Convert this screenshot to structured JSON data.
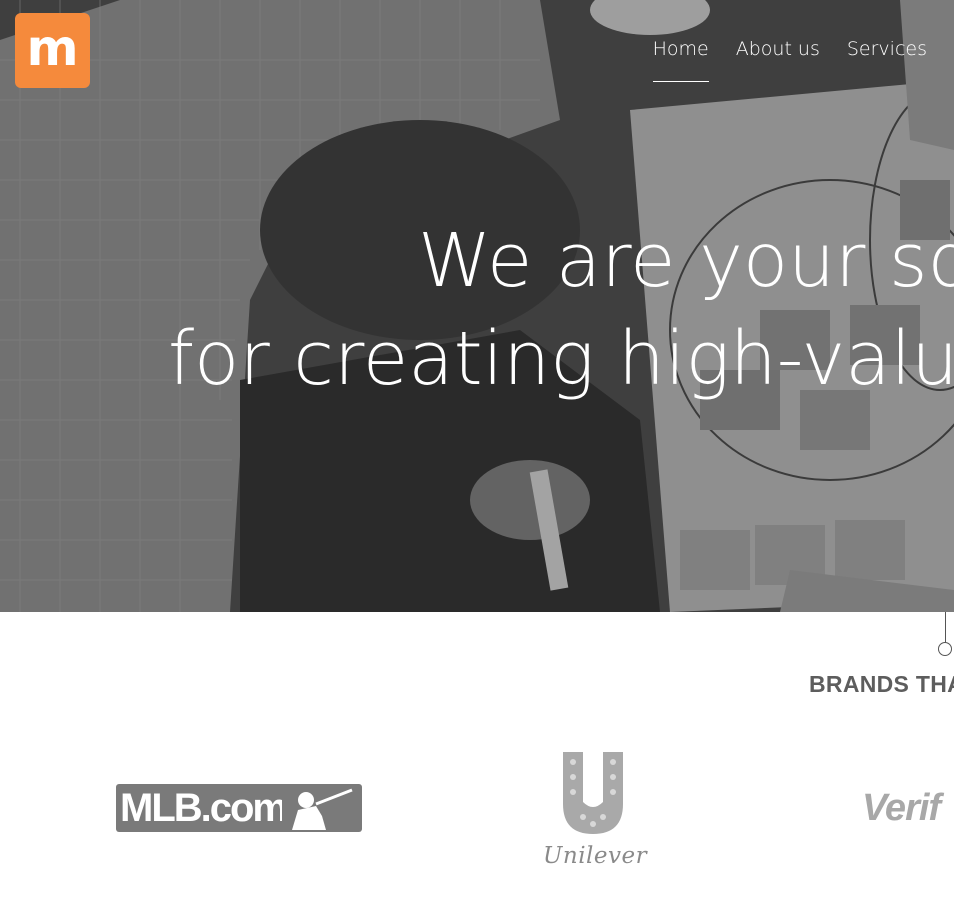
{
  "logo": {
    "letter": "m",
    "color": "#f58a3c"
  },
  "nav": {
    "items": [
      {
        "label": "Home",
        "active": true
      },
      {
        "label": "About us",
        "active": false
      },
      {
        "label": "Services",
        "active": false
      }
    ]
  },
  "hero": {
    "headline_line1": "We are your so",
    "headline_line2": "for creating high-value"
  },
  "brands": {
    "heading": "BRANDS THA",
    "logos": {
      "mlb": "MLB.com",
      "unilever": "Unilever",
      "verifone": "Verif"
    }
  }
}
